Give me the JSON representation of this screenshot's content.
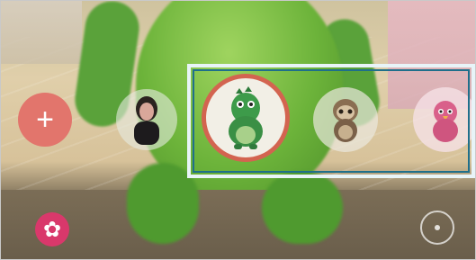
{
  "header": {},
  "toolbar": {
    "add_label": "+",
    "effects_label": "✿"
  },
  "stickers": {
    "items": [
      {
        "name": "person",
        "selected": false
      },
      {
        "name": "dinosaur",
        "selected": true
      },
      {
        "name": "sloth",
        "selected": false
      },
      {
        "name": "bird",
        "selected": false
      }
    ]
  },
  "icons": {
    "add": "plus-icon",
    "effects": "flower-icon",
    "switch_camera": "switch-camera-icon"
  },
  "colors": {
    "accent": "#d36450",
    "add_button": "#e2756c",
    "effects_button": "#d9386b",
    "highlight_border": "#1f6f8b"
  }
}
